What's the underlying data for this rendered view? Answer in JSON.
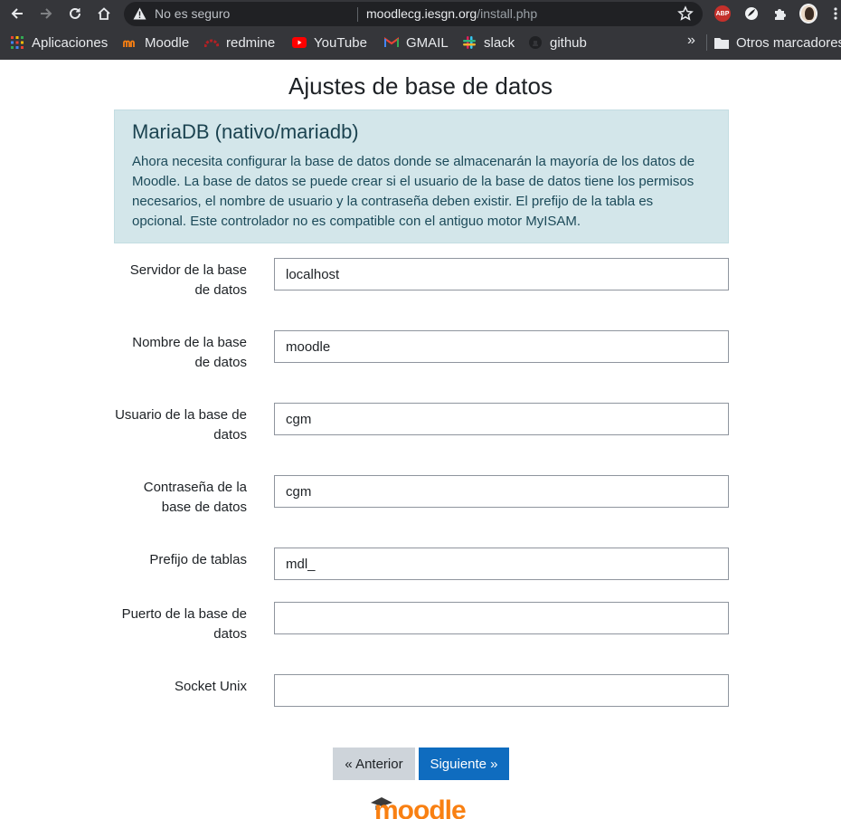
{
  "browser": {
    "insecure_label": "No es seguro",
    "url_host": "moodlecg.iesgn.org",
    "url_path": "/install.php",
    "bookmarks": [
      {
        "label": "Aplicaciones",
        "icon": "apps-grid-icon"
      },
      {
        "label": "Moodle",
        "icon": "moodle-favicon"
      },
      {
        "label": "redmine",
        "icon": "redmine-favicon"
      },
      {
        "label": "YouTube",
        "icon": "youtube-favicon"
      },
      {
        "label": "GMAIL",
        "icon": "gmail-favicon"
      },
      {
        "label": "slack",
        "icon": "slack-favicon"
      },
      {
        "label": "github",
        "icon": "github-favicon"
      }
    ],
    "overflow": "»",
    "other_bookmarks": "Otros marcadores",
    "extensions": [
      "adblock-plus-icon",
      "clover-extension-icon",
      "puzzle-extensions-icon",
      "profile-avatar"
    ],
    "abp_text": "ABP"
  },
  "page": {
    "title": "Ajustes de base de datos",
    "alert_heading": "MariaDB (nativo/mariadb)",
    "alert_text": "Ahora necesita configurar la base de datos donde se almacenarán la mayoría de los datos de Moodle. La base de datos se puede crear si el usuario de la base de datos tiene los permisos necesarios, el nombre de usuario y la contraseña deben existir. El prefijo de la tabla es opcional. Este controlador no es compatible con el antiguo motor MyISAM.",
    "fields": [
      {
        "label": "Servidor de la base de datos",
        "value": "localhost"
      },
      {
        "label": "Nombre de la base de datos",
        "value": "moodle"
      },
      {
        "label": "Usuario de la base de datos",
        "value": "cgm"
      },
      {
        "label": "Contraseña de la base de datos",
        "value": "cgm"
      },
      {
        "label": "Prefijo de tablas",
        "value": "mdl_"
      },
      {
        "label": "Puerto de la base de datos",
        "value": ""
      },
      {
        "label": "Socket Unix",
        "value": ""
      }
    ],
    "prev_button": "« Anterior",
    "next_button": "Siguiente »",
    "logo_text": "moodle"
  },
  "colors": {
    "chrome_bg": "#35363a",
    "alert_bg": "#d3e6ea",
    "primary_button": "#0f6cbf",
    "secondary_button": "#ced4da",
    "moodle_orange": "#f98012"
  }
}
